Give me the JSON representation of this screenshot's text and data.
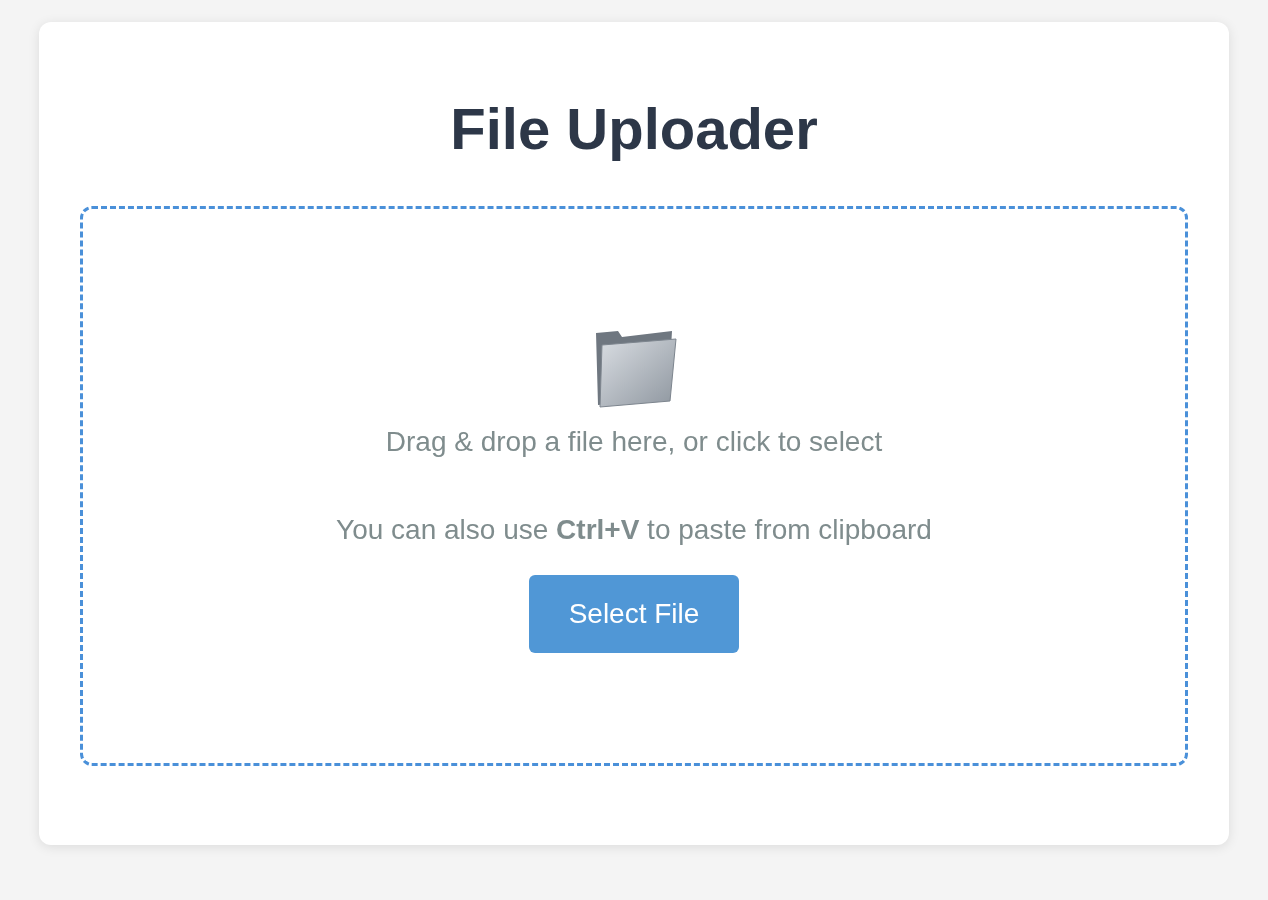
{
  "title": "File Uploader",
  "dropzone": {
    "instruction": "Drag & drop a file here, or click to select",
    "hint": "You can also use **Ctrl+V** to paste from clipboard",
    "button": "Select File"
  }
}
